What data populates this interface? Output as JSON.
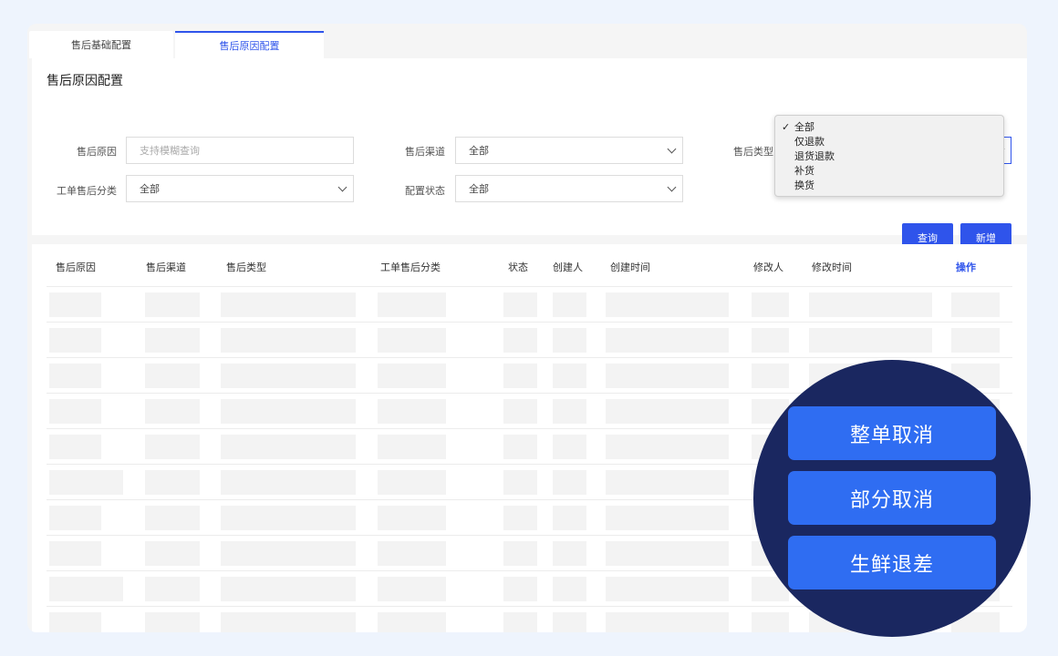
{
  "tabs": [
    {
      "label": "售后基础配置"
    },
    {
      "label": "售后原因配置"
    }
  ],
  "page_title": "售后原因配置",
  "filters": {
    "reason": {
      "label": "售后原因",
      "placeholder": "支持模糊查询"
    },
    "channel": {
      "label": "售后渠道",
      "value": "全部"
    },
    "type": {
      "label": "售后类型"
    },
    "category": {
      "label": "工单售后分类",
      "value": "全部"
    },
    "status": {
      "label": "配置状态",
      "value": "全部"
    }
  },
  "type_dropdown": {
    "selected_mark": "✓",
    "options": [
      "全部",
      "仅退款",
      "退货退款",
      "补货",
      "换货"
    ]
  },
  "buttons": {
    "query": "查询",
    "add": "新增"
  },
  "table": {
    "headers": [
      "售后原因",
      "售后渠道",
      "售后类型",
      "工单售后分类",
      "状态",
      "创建人",
      "创建时间",
      "修改人",
      "修改时间",
      "操作"
    ]
  },
  "overlay": {
    "options": [
      "整单取消",
      "部分取消",
      "生鲜退差"
    ]
  },
  "colors": {
    "accent": "#2f54eb",
    "overlay_bg": "#1a2760",
    "overlay_btn": "#2f6df2"
  }
}
